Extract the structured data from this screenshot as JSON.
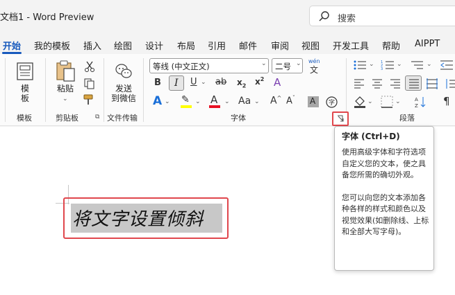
{
  "titlebar": {
    "doc_title": "文档1  -  Word Preview",
    "search_placeholder": "搜索"
  },
  "menu": [
    "开始",
    "我的模板",
    "插入",
    "绘图",
    "设计",
    "布局",
    "引用",
    "邮件",
    "审阅",
    "视图",
    "开发工具",
    "帮助",
    "AIPPT"
  ],
  "ribbon": {
    "template": {
      "button": "模\n板",
      "group": "模板"
    },
    "clipboard": {
      "paste": "粘贴",
      "group": "剪贴板"
    },
    "transfer": {
      "button": "发送\n到微信",
      "group": "文件传输"
    },
    "font": {
      "font_name": "等线 (中文正文)",
      "font_size": "二号",
      "group": "字体",
      "wen_top": "wén",
      "wen_bottom": "文"
    },
    "paragraph": {
      "group": "段落"
    }
  },
  "document": {
    "text": "将文字设置倾斜"
  },
  "tooltip": {
    "title": "字体 (Ctrl+D)",
    "para1": "使用高级字体和字符选项自定义您的文本，使之具备您所需的确切外观。",
    "para2": "您可以向您的文本添加各种各样的样式和颜色以及视觉效果(如删除线、上标和全部大写字母)。"
  },
  "colors": {
    "accent": "#185abd",
    "highlight_yellow": "#ffff00",
    "font_red": "#e81123",
    "frame_red": "#e0464c"
  }
}
